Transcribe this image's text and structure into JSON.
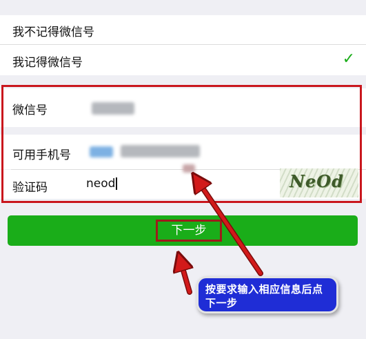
{
  "options": {
    "forgot_label": "我不记得微信号",
    "remember_label": "我记得微信号",
    "selected_icon": "check-icon"
  },
  "form": {
    "wechat_id_label": "微信号",
    "phone_label": "可用手机号",
    "code_label": "验证码",
    "code_value": "neod",
    "captcha_text": "NeOd"
  },
  "next_button": {
    "label": "下一步"
  },
  "annotation": {
    "callout_text": "按要求输入相应信息后点下一步",
    "highlight_color": "#c9161d",
    "callout_color": "#1f2dd6"
  },
  "colors": {
    "accent": "#1aad19",
    "background": "#efeff4"
  }
}
